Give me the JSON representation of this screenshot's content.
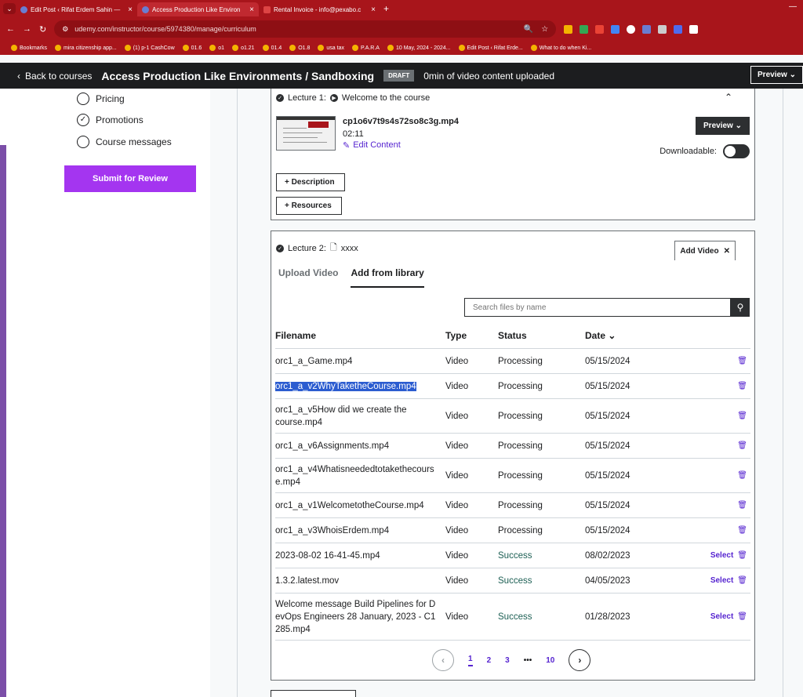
{
  "browser": {
    "tabs": [
      {
        "title": "Edit Post ‹ Rifat Erdem Sahin —",
        "active": false
      },
      {
        "title": "Access Production Like Environ",
        "active": true
      },
      {
        "title": "Rental Invoice - info@pexabo.c",
        "active": false
      }
    ],
    "url": "udemy.com/instructor/course/5974380/manage/curriculum",
    "bookmarks": [
      "Bookmarks",
      "mira citizenship app...",
      "(1) p-1 CashCow",
      "01.6",
      "o1",
      "o1.21",
      "01.4",
      "O1.8",
      "usa tax",
      "P.A.R.A",
      "10 May, 2024 - 2024...",
      "Edit Post ‹ Rifat Erde...",
      "What to do when Ki..."
    ]
  },
  "header": {
    "back_label": "Back to courses",
    "course_title": "Access Production Like Environments / Sandboxing",
    "draft_badge": "DRAFT",
    "upload_status": "0min of video content uploaded",
    "preview_label": "Preview"
  },
  "sidebar": {
    "items": [
      {
        "label": "Pricing",
        "checked": false
      },
      {
        "label": "Promotions",
        "checked": true
      },
      {
        "label": "Course messages",
        "checked": false
      }
    ],
    "submit_label": "Submit for Review"
  },
  "lecture1": {
    "prefix": "Lecture 1:",
    "title": "Welcome to the course",
    "file_name": "cp1o6v7t9s4s72so8c3g.mp4",
    "duration": "02:11",
    "edit_label": "Edit Content",
    "preview_label": "Preview",
    "downloadable_label": "Downloadable:",
    "description_label": "Description",
    "resources_label": "Resources"
  },
  "lecture2": {
    "prefix": "Lecture 2:",
    "title": "xxxx",
    "add_video_label": "Add Video",
    "tabs": [
      "Upload Video",
      "Add from library"
    ],
    "search_placeholder": "Search files by name",
    "columns": {
      "filename": "Filename",
      "type": "Type",
      "status": "Status",
      "date": "Date"
    },
    "rows": [
      {
        "filename": "orc1_a_Game.mp4",
        "type": "Video",
        "status": "Processing",
        "date": "05/15/2024",
        "select": ""
      },
      {
        "filename": "orc1_a_v2WhyTaketheCourse.mp4",
        "type": "Video",
        "status": "Processing",
        "date": "05/15/2024",
        "select": ""
      },
      {
        "filename": "orc1_a_v5How did we create the course.mp4",
        "type": "Video",
        "status": "Processing",
        "date": "05/15/2024",
        "select": ""
      },
      {
        "filename": "orc1_a_v6Assignments.mp4",
        "type": "Video",
        "status": "Processing",
        "date": "05/15/2024",
        "select": ""
      },
      {
        "filename": "orc1_a_v4Whatisneededtotakethecourse.mp4",
        "type": "Video",
        "status": "Processing",
        "date": "05/15/2024",
        "select": ""
      },
      {
        "filename": "orc1_a_v1WelcometotheCourse.mp4",
        "type": "Video",
        "status": "Processing",
        "date": "05/15/2024",
        "select": ""
      },
      {
        "filename": "orc1_a_v3WhoisErdem.mp4",
        "type": "Video",
        "status": "Processing",
        "date": "05/15/2024",
        "select": ""
      },
      {
        "filename": "2023-08-02 16-41-45.mp4",
        "type": "Video",
        "status": "Success",
        "date": "08/02/2023",
        "select": "Select"
      },
      {
        "filename": "1.3.2.latest.mov",
        "type": "Video",
        "status": "Success",
        "date": "04/05/2023",
        "select": "Select"
      },
      {
        "filename": "Welcome message Build Pipelines for DevOps Engineers 28 January, 2023 - C1285.mp4",
        "type": "Video",
        "status": "Success",
        "date": "01/28/2023",
        "select": "Select"
      }
    ],
    "pagination": {
      "pages": [
        "1",
        "2",
        "3",
        "10"
      ],
      "ellipsis": "•••",
      "current": "1"
    }
  },
  "colors": {
    "brand_purple": "#a435f0",
    "link_purple": "#5624d0",
    "success_green": "#1e6055",
    "chrome_red": "#a8151b"
  }
}
